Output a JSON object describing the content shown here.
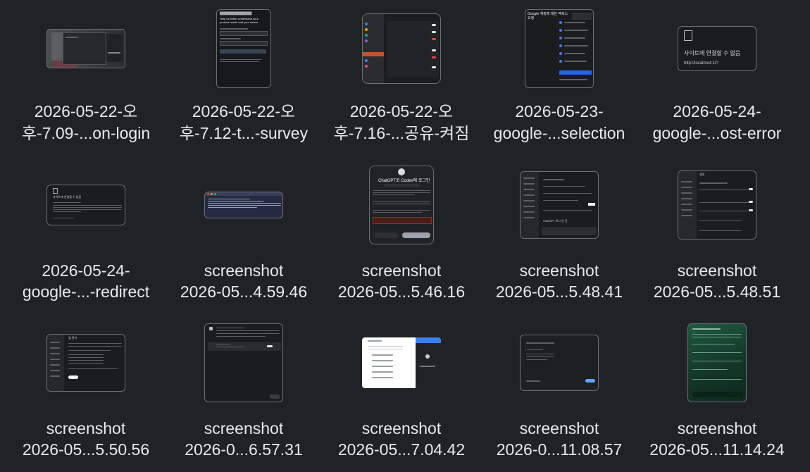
{
  "files": [
    {
      "line1": "2026-05-22-오",
      "line2": "후-7.09-...on-login",
      "thumb": "dark-dialog"
    },
    {
      "line1": "2026-05-22-오",
      "line2": "후-7.12-t...-survey",
      "thumb": "survey-form"
    },
    {
      "line1": "2026-05-22-오",
      "line2": "후-7.16-...공유-켜짐",
      "thumb": "settings-toggles"
    },
    {
      "line1": "2026-05-23-",
      "line2": "google-...selection",
      "thumb": "account-list"
    },
    {
      "line1": "2026-05-24-",
      "line2": "google-...ost-error",
      "thumb": "connection-error"
    },
    {
      "line1": "2026-05-24-",
      "line2": "google-...-redirect",
      "thumb": "redirect-error"
    },
    {
      "line1": "screenshot",
      "line2": "2026-05...4.59.46",
      "thumb": "terminal"
    },
    {
      "line1": "screenshot",
      "line2": "2026-05...5.46.16",
      "thumb": "login-dialog"
    },
    {
      "line1": "screenshot",
      "line2": "2026-05...5.48.41",
      "thumb": "chat-app"
    },
    {
      "line1": "screenshot",
      "line2": "2026-05...5.48.51",
      "thumb": "settings-app"
    },
    {
      "line1": "screenshot",
      "line2": "2026-05...5.50.56",
      "thumb": "sidebar-app"
    },
    {
      "line1": "screenshot",
      "line2": "2026-0...6.57.31",
      "thumb": "empty-panel"
    },
    {
      "line1": "screenshot",
      "line2": "2026-05...7.04.42",
      "thumb": "split-page"
    },
    {
      "line1": "screenshot",
      "line2": "2026-0...11.08.57",
      "thumb": "light-card"
    },
    {
      "line1": "screenshot",
      "line2": "2026-05...11.14.24",
      "thumb": "green-app"
    }
  ],
  "thumb_text": {
    "connection_error": "사이트에 연결할 수 없음",
    "localhost": "http://localhost:1/?",
    "redirect_error": "사이트에 연결할 수 없음",
    "login_title": "ChatGPT로 Codex에 로그인",
    "settings_header": "설정",
    "chat_preview": "ChatGPT 로그 인 단",
    "sidebar_title": "앱 관리",
    "ok_label": "확인",
    "google_title": "Google 계정에 대한 액세스 요청",
    "survey_title": "Help us better understand your product needs and your career"
  }
}
